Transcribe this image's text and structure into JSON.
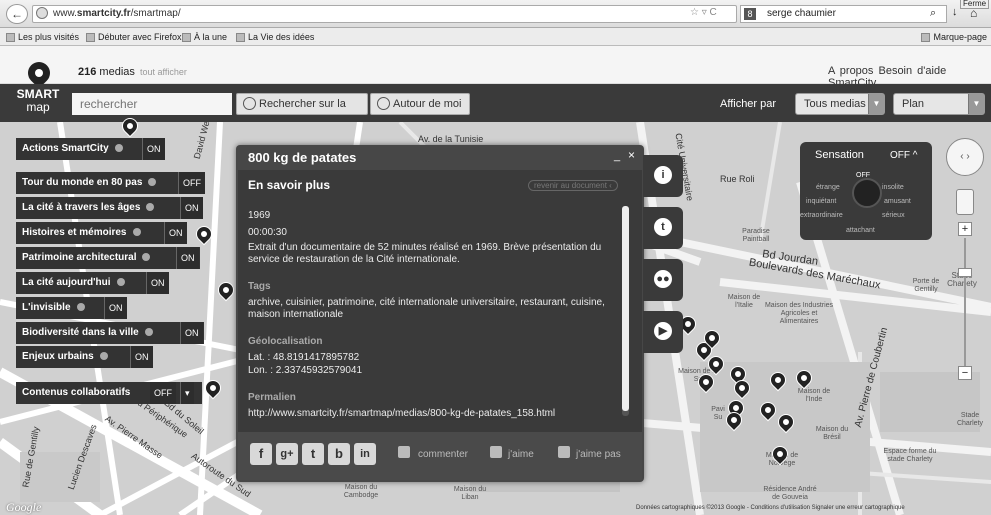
{
  "browser": {
    "url_prefix": "www.",
    "url_domain": "smartcity.fr",
    "url_path": "/smartmap/",
    "search_engine_icon": "8",
    "search_value": "serge chaumier",
    "close_tab": "Ferme",
    "bookmarks": [
      "Les plus visités",
      "Débuter avec Firefox",
      "À la une",
      "La Vie des idées"
    ],
    "bookmarks_menu": "Marque-page"
  },
  "app": {
    "media_count": "216",
    "media_label": "medias",
    "show_all": "tout afficher",
    "links": [
      "A propos",
      "Besoin d'aide",
      "SmartCity"
    ],
    "logo_line1": "SMART",
    "logo_line2": "map",
    "search_placeholder": "rechercher",
    "btn_search": "Rechercher sur la",
    "btn_around": "Autour de moi",
    "afficher_par": "Afficher par",
    "select_medias": "Tous medias",
    "select_plan": "Plan"
  },
  "layers": [
    {
      "label": "Actions SmartCity",
      "state": "ON"
    },
    {
      "label": "Tour du monde en 80 pas",
      "state": "OFF"
    },
    {
      "label": "La cité à travers les âges",
      "state": "ON"
    },
    {
      "label": "Histoires et mémoires",
      "state": "ON"
    },
    {
      "label": "Patrimoine architectural",
      "state": "ON"
    },
    {
      "label": "La cité aujourd'hui",
      "state": "ON"
    },
    {
      "label": "L'invisible",
      "state": "ON"
    },
    {
      "label": "Biodiversité dans la ville",
      "state": "ON"
    },
    {
      "label": "Enjeux urbains",
      "state": "ON"
    },
    {
      "label": "Contenus collaboratifs",
      "state": "OFF"
    }
  ],
  "popup": {
    "title": "800 kg de patates",
    "minimize": "_",
    "close": "×",
    "section": "En savoir plus",
    "back_link": "revenir au document",
    "year": "1969",
    "duration": "00:00:30",
    "description": "Extrait d'un documentaire de 52 minutes réalisé en 1969. Brève présentation du service de restauration de la Cité internationale.",
    "tags_heading": "Tags",
    "tags": "archive, cuisinier, patrimoine, cité internationale universitaire, restaurant, cuisine, maison internationale",
    "geo_heading": "Géolocalisation",
    "lat": "Lat. : 48.8191417895782",
    "lon": "Lon. : 2.33745932579041",
    "permalink_heading": "Permalien",
    "permalink": "http://www.smartcity.fr/smartmap/medias/800-kg-de-patates_158.html",
    "social": [
      "f",
      "g+",
      "t",
      "b",
      "in"
    ],
    "comment": "commenter",
    "like": "j'aime",
    "dislike": "j'aime pas",
    "side_icons": [
      "info-icon",
      "twitter-icon",
      "flickr-icon",
      "youtube-icon"
    ]
  },
  "sensation": {
    "title": "Sensation",
    "state": "OFF",
    "wheel_off": "OFF",
    "labels": [
      "étrange",
      "insolite",
      "inquiétant",
      "amusant",
      "extraordinaire",
      "sérieux",
      "attachant"
    ]
  },
  "map": {
    "roads": [
      "Av. de la Tunisie",
      "Bd Jourdan",
      "Boulevards des Maréchaux",
      "Av. Pierre de Coubertin",
      "Autoroute du Sud",
      "Bd Périphérique",
      "Av. Pierre Masse",
      "Rue Roli",
      "Bd du Soleil",
      "Lucien Descaves",
      "Rue de Gentilly",
      "David Weill",
      "Cité Universitaire"
    ],
    "places": [
      "Paradise Paintball",
      "Porte de Gentilly",
      "Stade Charlety",
      "Maison de l'Italie",
      "Maison des Industries Agricoles et Alimentaires",
      "Maison de l'Inde",
      "Maison du Brésil",
      "Maison de Norvège",
      "Espace forme du stade Charlety",
      "Résidence André de Gouveia",
      "Maison du Liban",
      "Maison du Cambodge",
      "Stade Charlety",
      "Pavi Su",
      "Maison de la Su"
    ],
    "google": "Google",
    "footnote": "Données cartographiques ©2013 Google - Conditions d'utilisation   Signaler une erreur cartographique"
  }
}
